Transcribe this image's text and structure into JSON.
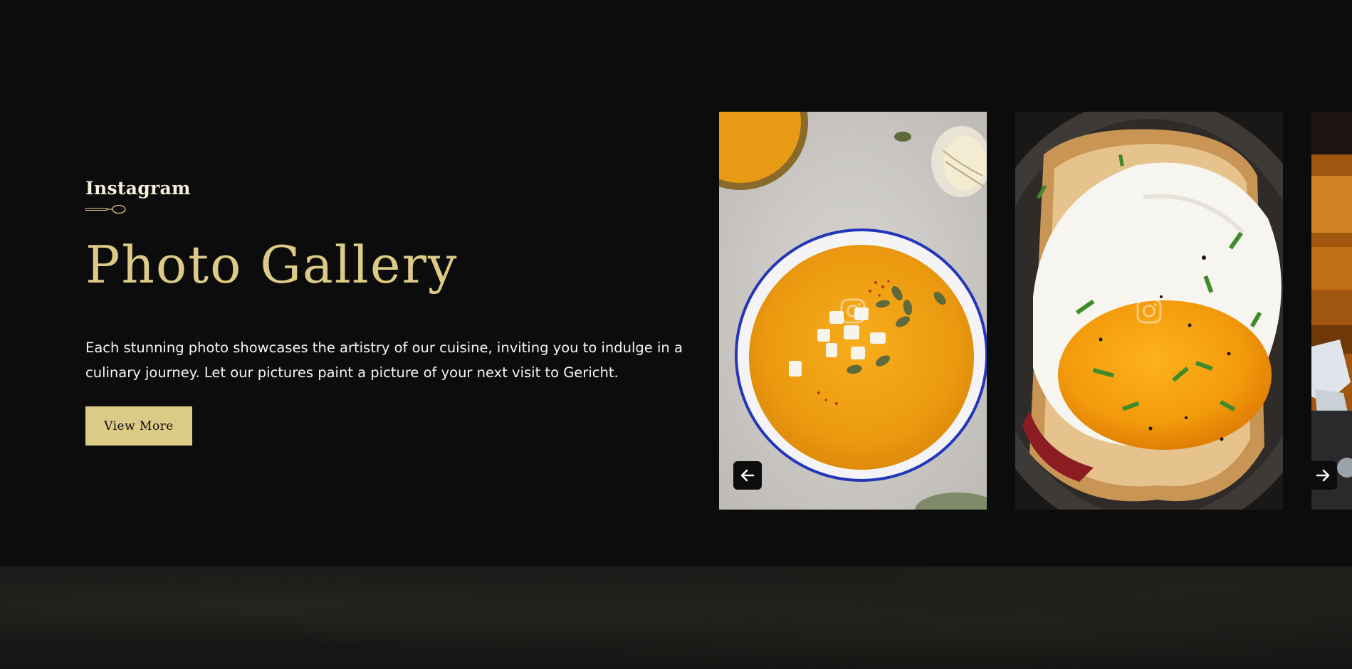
{
  "section": {
    "eyebrow": "Instagram",
    "title": "Photo Gallery",
    "description": "Each stunning photo showcases the artistry of our cuisine, inviting you to indulge in a culinary journey. Let our pictures paint a picture of your next visit to Gericht.",
    "button_label": "View More"
  },
  "gallery": {
    "images": [
      {
        "subject": "pumpkin soup in white bowl",
        "overlay_icon": "instagram-icon"
      },
      {
        "subject": "fried egg on toast with chives",
        "overlay_icon": "instagram-icon"
      },
      {
        "subject": "drink with ice",
        "overlay_icon": "instagram-icon"
      }
    ],
    "prev_icon": "arrow-left-icon",
    "next_icon": "arrow-right-icon"
  },
  "colors": {
    "background": "#0c0c0c",
    "gold": "#dcca87",
    "white": "#ffffff",
    "cream": "#f5efdb"
  }
}
